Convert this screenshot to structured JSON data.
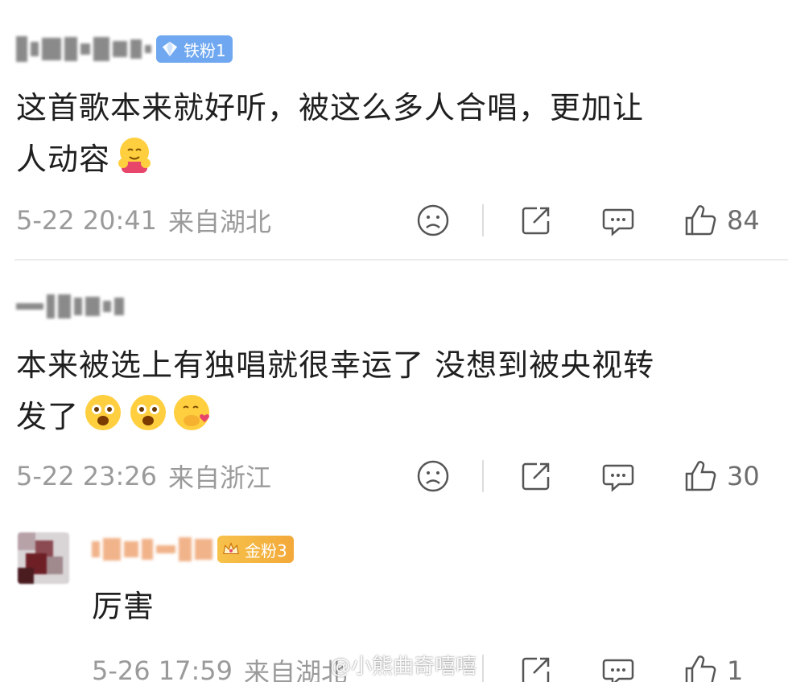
{
  "comments": [
    {
      "badge": "铁粉1",
      "text_line1": "这首歌本来就好听，被这么多人合唱，更加让",
      "text_line2": "人动容",
      "date": "5-22 20:41",
      "location": "来自湖北",
      "likes": "84",
      "emojis": [
        "hug-emoji"
      ]
    },
    {
      "text_line1": "本来被选上有独唱就很幸运了 没想到被央视转",
      "text_line2": "发了",
      "date": "5-22 23:26",
      "location": "来自浙江",
      "likes": "30",
      "emojis": [
        "starstruck-emoji",
        "starstruck-emoji",
        "heart-hands-emoji"
      ]
    },
    {
      "badge": "金粉3",
      "text": "厉害",
      "date": "5-26 17:59",
      "location": "来自湖北",
      "likes": "1"
    }
  ],
  "watermark": "@小熊曲奇嘻嘻",
  "colors": {
    "iron_badge": "#6fa8f0",
    "gold_badge": "#f3a93a",
    "meta_text": "#9a9a9a",
    "body_text": "#1f1f1f"
  }
}
